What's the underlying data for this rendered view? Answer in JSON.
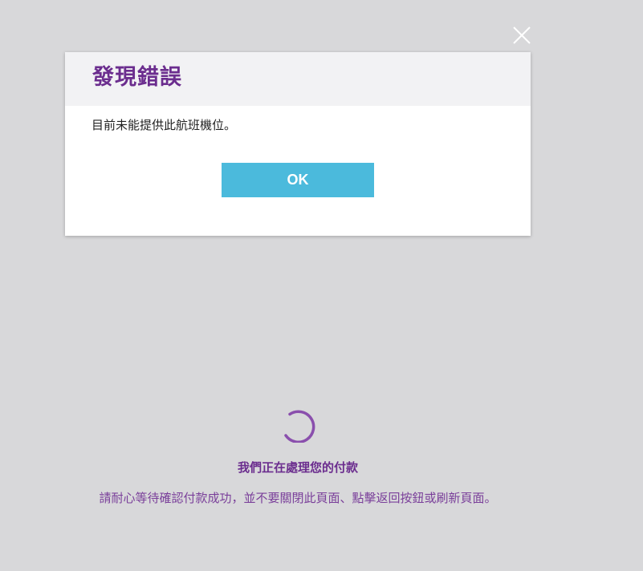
{
  "dialog": {
    "close_icon": "close-icon",
    "title": "發現錯誤",
    "message": "目前未能提供此航班機位。",
    "ok_label": "OK"
  },
  "background": {
    "spinner_icon": "loading-spinner-icon",
    "processing_title": "我們正在處理您的付款",
    "processing_note": "請耐心等待確認付款成功，並不要關閉此頁面、點擊返回按鈕或刷新頁面。"
  },
  "colors": {
    "overlay_background": "#d8d8da",
    "title_purple": "#6b2d8e",
    "ok_button": "#4bbadc",
    "spinner": "#8a4fad"
  }
}
